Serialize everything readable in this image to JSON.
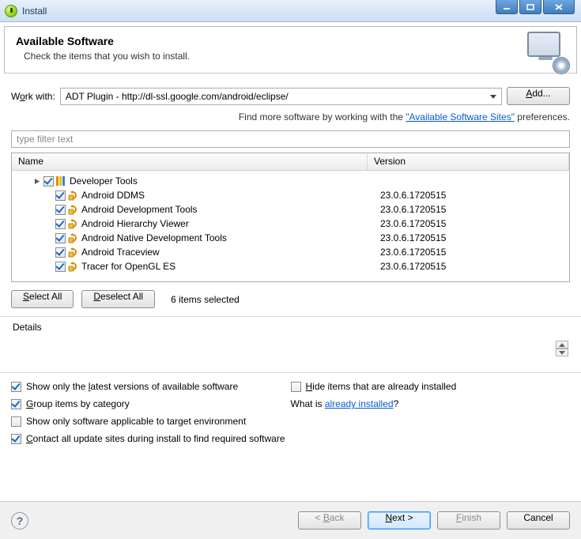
{
  "window": {
    "title": "Install"
  },
  "banner": {
    "heading": "Available Software",
    "sub": "Check the items that you wish to install."
  },
  "workwith": {
    "label_pre": "W",
    "label_accel": "o",
    "label_post": "rk with:",
    "value": "ADT Plugin - http://dl-ssl.google.com/android/eclipse/",
    "add_pre": "",
    "add_accel": "A",
    "add_post": "dd..."
  },
  "hint": {
    "pre": "Find more software by working with the ",
    "link": "\"Available Software Sites\"",
    "post": " preferences."
  },
  "filter_placeholder": "type filter text",
  "columns": {
    "name": "Name",
    "version": "Version"
  },
  "tree": {
    "category": "Developer Tools",
    "items": [
      {
        "name": "Android DDMS",
        "version": "23.0.6.1720515"
      },
      {
        "name": "Android Development Tools",
        "version": "23.0.6.1720515"
      },
      {
        "name": "Android Hierarchy Viewer",
        "version": "23.0.6.1720515"
      },
      {
        "name": "Android Native Development Tools",
        "version": "23.0.6.1720515"
      },
      {
        "name": "Android Traceview",
        "version": "23.0.6.1720515"
      },
      {
        "name": "Tracer for OpenGL ES",
        "version": "23.0.6.1720515"
      }
    ]
  },
  "selbar": {
    "select_pre": "",
    "select_accel": "S",
    "select_post": "elect All",
    "deselect_pre": "",
    "deselect_accel": "D",
    "deselect_post": "eselect All",
    "count": "6 items selected"
  },
  "details_label": "Details",
  "options": {
    "o1_pre": "Show only the ",
    "o1_accel": "l",
    "o1_post": "atest versions of available software",
    "o2_pre": "",
    "o2_accel": "H",
    "o2_post": "ide items that are already installed",
    "o3_pre": "",
    "o3_accel": "G",
    "o3_post": "roup items by category",
    "whatis_pre": "What is ",
    "whatis_link": "already installed",
    "whatis_post": "?",
    "o4": "Show only software applicable to target environment",
    "o5_pre": "",
    "o5_accel": "C",
    "o5_post": "ontact all update sites during install to find required software"
  },
  "footer": {
    "back_pre": "< ",
    "back_accel": "B",
    "back_post": "ack",
    "next_pre": "",
    "next_accel": "N",
    "next_post": "ext >",
    "finish_pre": "",
    "finish_accel": "F",
    "finish_post": "inish",
    "cancel": "Cancel"
  }
}
